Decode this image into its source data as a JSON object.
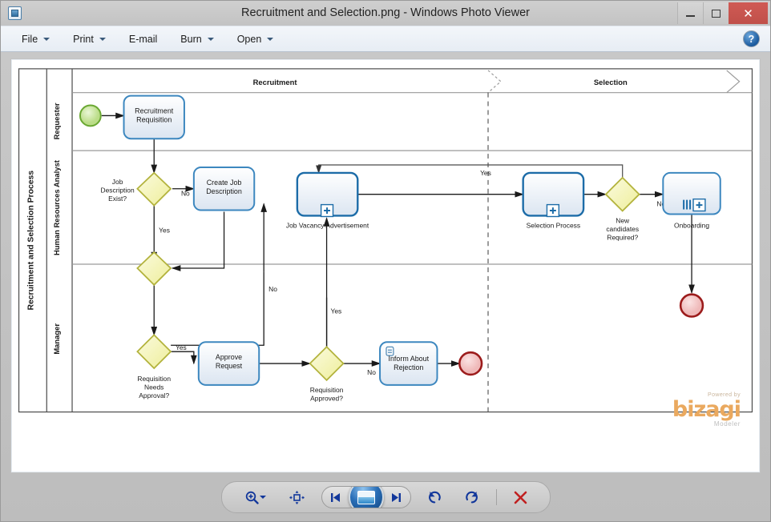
{
  "window": {
    "title": "Recruitment and Selection.png - Windows Photo Viewer",
    "app_icon": "photo-viewer-icon",
    "minimize_label": "Minimize",
    "maximize_label": "Maximize",
    "close_label": "Close"
  },
  "menubar": {
    "items": [
      {
        "label": "File",
        "has_caret": true
      },
      {
        "label": "Print",
        "has_caret": true
      },
      {
        "label": "E-mail",
        "has_caret": false
      },
      {
        "label": "Burn",
        "has_caret": true
      },
      {
        "label": "Open",
        "has_caret": true
      }
    ],
    "help_label": "?"
  },
  "diagram": {
    "pool_label": "Recruitment and Selection Process",
    "phases": [
      {
        "label": "Recruitment"
      },
      {
        "label": "Selection"
      }
    ],
    "lanes": [
      {
        "label": "Requester"
      },
      {
        "label": "Human Resources Analyst"
      },
      {
        "label": "Manager"
      }
    ],
    "nodes": [
      {
        "id": "start",
        "type": "start-event",
        "label": ""
      },
      {
        "id": "req",
        "type": "task",
        "label": "Recruitment Requisition"
      },
      {
        "id": "gw_jd_exist",
        "type": "gateway",
        "label": "Job Description Exist?"
      },
      {
        "id": "create_jd",
        "type": "task",
        "label": "Create Job Description"
      },
      {
        "id": "gw_merge",
        "type": "gateway",
        "label": ""
      },
      {
        "id": "job_vacancy",
        "type": "subprocess",
        "label": "Job Vacancy Advertisement"
      },
      {
        "id": "selection",
        "type": "subprocess",
        "label": "Selection Process"
      },
      {
        "id": "gw_new_cand",
        "type": "gateway",
        "label": "New candidates Required?"
      },
      {
        "id": "onboarding",
        "type": "subprocess-multi",
        "label": "Onboarding"
      },
      {
        "id": "end_onboard",
        "type": "end-event",
        "label": ""
      },
      {
        "id": "gw_needs_app",
        "type": "gateway",
        "label": "Requisition Needs Approval?"
      },
      {
        "id": "approve",
        "type": "task",
        "label": "Approve Request"
      },
      {
        "id": "gw_approved",
        "type": "gateway",
        "label": "Requisition Approved?"
      },
      {
        "id": "inform",
        "type": "task-manual",
        "label": "Inform About Rejection"
      },
      {
        "id": "end_reject",
        "type": "end-event",
        "label": ""
      }
    ],
    "flow_labels": [
      {
        "id": "jd_no",
        "text": "No"
      },
      {
        "id": "jd_yes",
        "text": "Yes"
      },
      {
        "id": "needs_yes",
        "text": "Yes"
      },
      {
        "id": "needs_no",
        "text": "No"
      },
      {
        "id": "approved_yes",
        "text": "Yes"
      },
      {
        "id": "approved_no",
        "text": "No"
      },
      {
        "id": "cand_yes",
        "text": "Yes"
      },
      {
        "id": "cand_no",
        "text": "No"
      }
    ],
    "colors": {
      "task_border": "#3c87bf",
      "task_fill_top": "#ffffff",
      "task_fill_bottom": "#dce6f2",
      "gateway_border": "#b3b33d",
      "gateway_fill": "#f7f7c8",
      "start_border": "#6aa832",
      "start_fill": "#cce8a0",
      "end_border": "#9c1c1c",
      "end_fill": "#f2c4c4",
      "flow_line": "#1a1a1a",
      "lane_border": "#9a9a9a"
    }
  },
  "watermark": {
    "powered_by": "Powered by",
    "brand": "bizagi",
    "product": "Modeler"
  },
  "bottom_toolbar": {
    "buttons": [
      {
        "id": "zoom",
        "icon": "magnifier-plus-icon",
        "label": "Zoom"
      },
      {
        "id": "fit",
        "icon": "fit-to-window-icon",
        "label": "Fit to window"
      },
      {
        "id": "previous",
        "icon": "previous-icon",
        "label": "Previous"
      },
      {
        "id": "slideshow",
        "icon": "slideshow-icon",
        "label": "Play slide show"
      },
      {
        "id": "next",
        "icon": "next-icon",
        "label": "Next"
      },
      {
        "id": "rotate_ccw",
        "icon": "rotate-ccw-icon",
        "label": "Rotate counterclockwise"
      },
      {
        "id": "rotate_cw",
        "icon": "rotate-cw-icon",
        "label": "Rotate clockwise"
      },
      {
        "id": "delete",
        "icon": "delete-x-icon",
        "label": "Delete"
      }
    ]
  }
}
